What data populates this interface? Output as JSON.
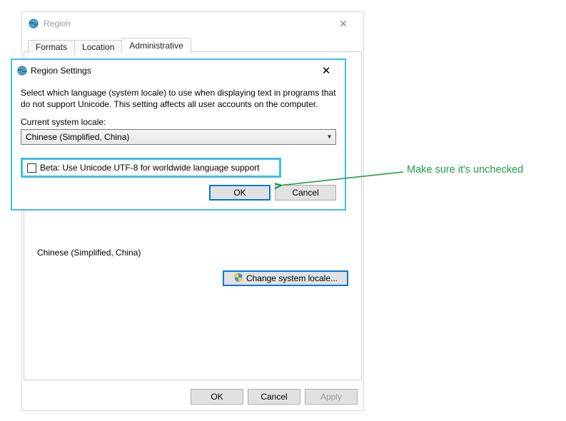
{
  "region_window": {
    "title": "Region",
    "tabs": {
      "formats": "Formats",
      "location": "Location",
      "administrative": "Administrative"
    },
    "current_locale_value": "Chinese (Simplified, China)",
    "change_locale_btn": "Change system locale...",
    "buttons": {
      "ok": "OK",
      "cancel": "Cancel",
      "apply": "Apply"
    }
  },
  "settings_dialog": {
    "title": "Region Settings",
    "description": "Select which language (system locale) to use when displaying text in programs that do not support Unicode. This setting affects all user accounts on the computer.",
    "locale_label": "Current system locale:",
    "locale_value": "Chinese (Simplified, China)",
    "beta_checkbox_label": "Beta: Use Unicode UTF-8 for worldwide language support",
    "beta_checked": false,
    "buttons": {
      "ok": "OK",
      "cancel": "Cancel"
    }
  },
  "annotation": {
    "text": "Make sure it's unchecked"
  }
}
